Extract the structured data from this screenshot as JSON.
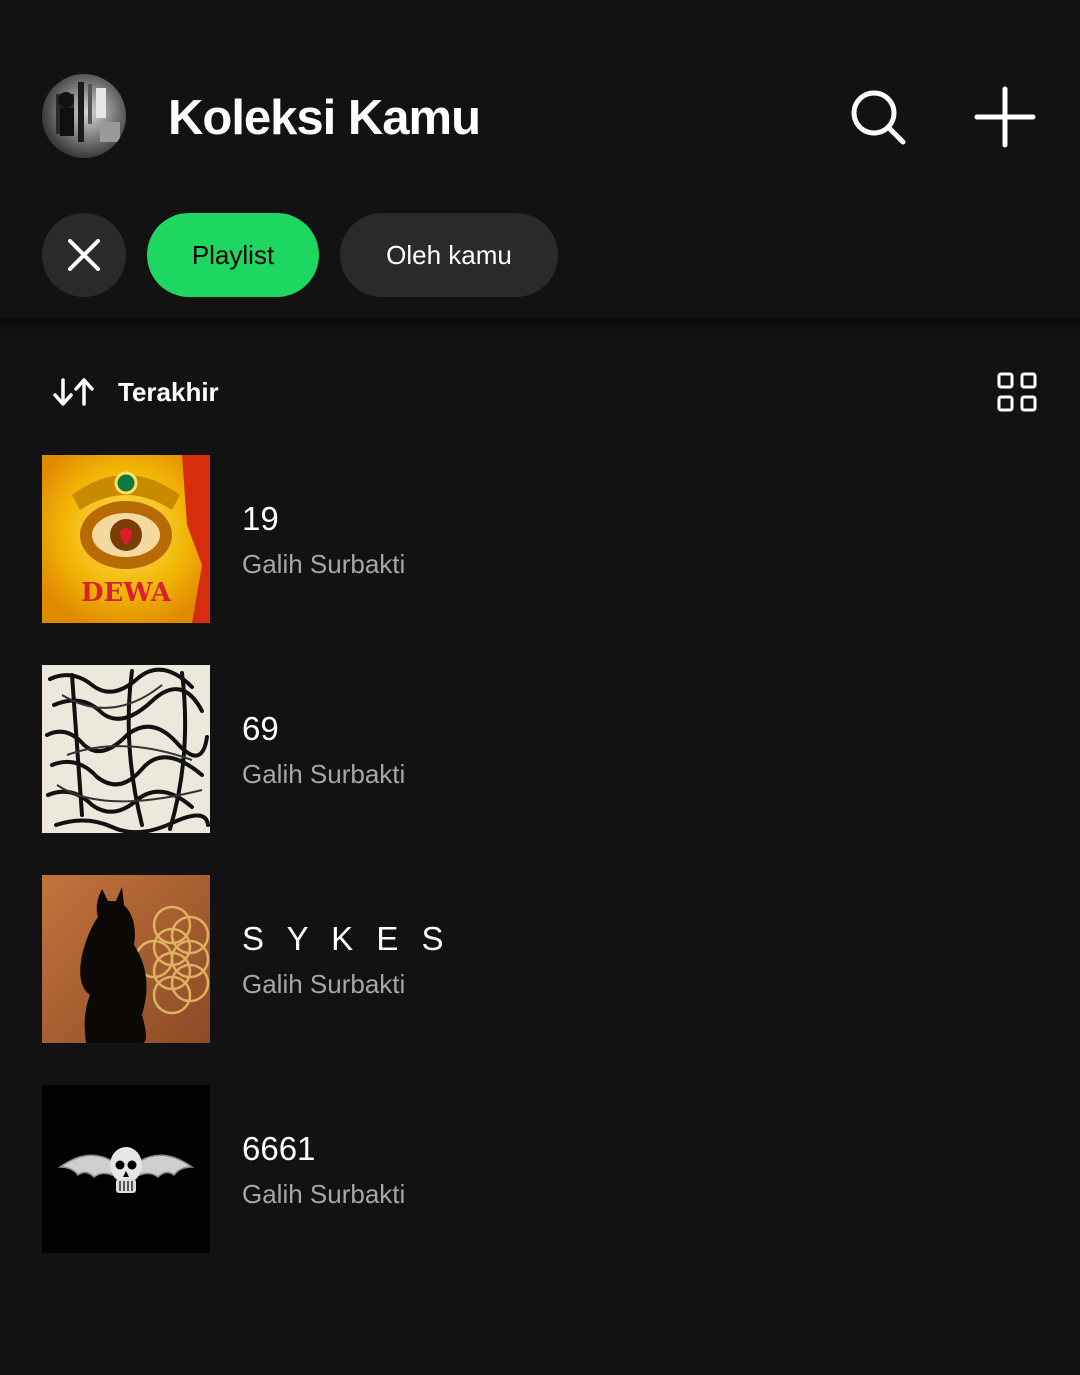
{
  "header": {
    "title": "Koleksi Kamu",
    "search_icon": "search-icon",
    "add_icon": "plus-icon"
  },
  "filters": {
    "close_icon": "close-icon",
    "chips": [
      {
        "label": "Playlist",
        "selected": true
      },
      {
        "label": "Oleh kamu",
        "selected": false
      }
    ]
  },
  "sort": {
    "icon": "sort-arrows-icon",
    "label": "Terakhir",
    "view_icon": "grid-view-icon"
  },
  "playlists": [
    {
      "title": "19",
      "owner": "Galih Surbakti",
      "cover_text": "DEWA"
    },
    {
      "title": "69",
      "owner": "Galih Surbakti"
    },
    {
      "title": "S Y K E S",
      "owner": "Galih Surbakti"
    },
    {
      "title": "6661",
      "owner": "Galih Surbakti"
    }
  ],
  "colors": {
    "background": "#121212",
    "accent": "#1ed760",
    "chip_bg": "#2a2a2a",
    "secondary_text": "#a7a7a7"
  }
}
